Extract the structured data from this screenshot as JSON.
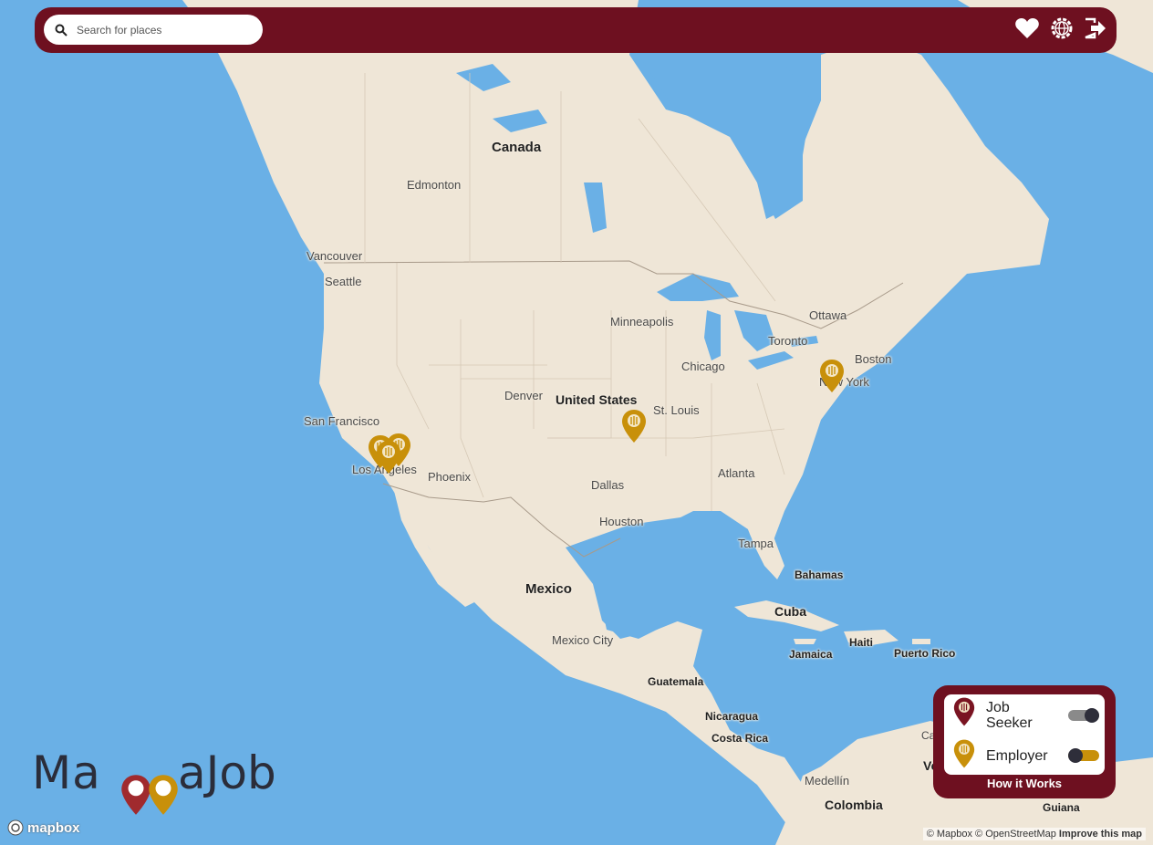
{
  "search": {
    "placeholder": "Search for places"
  },
  "header_icons": [
    "heart-icon",
    "globe-settings-icon",
    "logout-icon"
  ],
  "colors": {
    "brand": "#6e1020",
    "job_seeker_pin": "#7a1422",
    "employer_pin": "#c8900a",
    "water": "#6ab0e6",
    "land": "#efe6d7"
  },
  "places": {
    "canada": "Canada",
    "united_states": "United States",
    "mexico": "Mexico",
    "cuba": "Cuba",
    "colombia": "Colombia",
    "edmonton": "Edmonton",
    "vancouver": "Vancouver",
    "seattle": "Seattle",
    "minneapolis": "Minneapolis",
    "ottawa": "Ottawa",
    "toronto": "Toronto",
    "boston": "Boston",
    "chicago": "Chicago",
    "new_york": "New York",
    "denver": "Denver",
    "st_louis": "St. Louis",
    "san_francisco": "San Francisco",
    "los_angeles": "Los Angeles",
    "phoenix": "Phoenix",
    "dallas": "Dallas",
    "atlanta": "Atlanta",
    "houston": "Houston",
    "tampa": "Tampa",
    "bahamas": "Bahamas",
    "mexico_city": "Mexico City",
    "jamaica": "Jamaica",
    "haiti": "Haiti",
    "puerto_rico": "Puerto Rico",
    "guatemala": "Guatemala",
    "nicaragua": "Nicaragua",
    "costa_rica": "Costa Rica",
    "medellin": "Medellín",
    "caracas": "Caraca",
    "venezuela": "Venez",
    "guiana": "Guiana"
  },
  "legend": {
    "job_seeker_line1": "Job",
    "job_seeker_line2": "Seeker",
    "employer": "Employer",
    "how_it_works": "How it Works",
    "job_seeker_on": true,
    "employer_on": false
  },
  "logo": {
    "part1": "Ma",
    "part2": "aJob"
  },
  "mapbox_label": "mapbox",
  "attribution": {
    "text": "© Mapbox © OpenStreetMap",
    "improve": "Improve this map"
  }
}
